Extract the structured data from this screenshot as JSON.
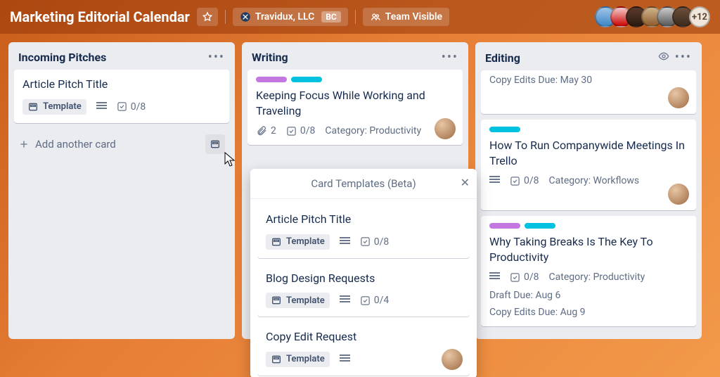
{
  "header": {
    "board_title": "Marketing Editorial Calendar",
    "org_name": "Travidux, LLC",
    "org_badge": "BC",
    "visibility_label": "Team Visible",
    "more_members": "+12"
  },
  "lists": {
    "incoming": {
      "title": "Incoming Pitches",
      "card1": {
        "title": "Article Pitch Title",
        "template_label": "Template",
        "checklist": "0/8"
      },
      "add_card_label": "Add another card"
    },
    "writing": {
      "title": "Writing",
      "card1": {
        "title": "Keeping Focus While Working and Traveling",
        "attachments": "2",
        "checklist": "0/8",
        "category": "Category: Productivity"
      }
    },
    "editing": {
      "title": "Editing",
      "card0": {
        "due_line": "Copy Edits Due: May 30"
      },
      "card1": {
        "title": "How To Run Companywide Meetings In Trello",
        "checklist": "0/8",
        "category": "Category: Workflows"
      },
      "card2": {
        "title": "Why Taking Breaks Is The Key To Productivity",
        "checklist": "0/8",
        "category": "Category: Productivity",
        "draft_due": "Draft Due: Aug 6",
        "copy_due": "Copy Edits Due: Aug 9"
      }
    }
  },
  "popup": {
    "title": "Card Templates (Beta)",
    "t1": {
      "title": "Article Pitch Title",
      "template_label": "Template",
      "checklist": "0/8"
    },
    "t2": {
      "title": "Blog Design Requests",
      "template_label": "Template",
      "checklist": "0/4"
    },
    "t3": {
      "title": "Copy Edit Request",
      "template_label": "Template"
    }
  }
}
